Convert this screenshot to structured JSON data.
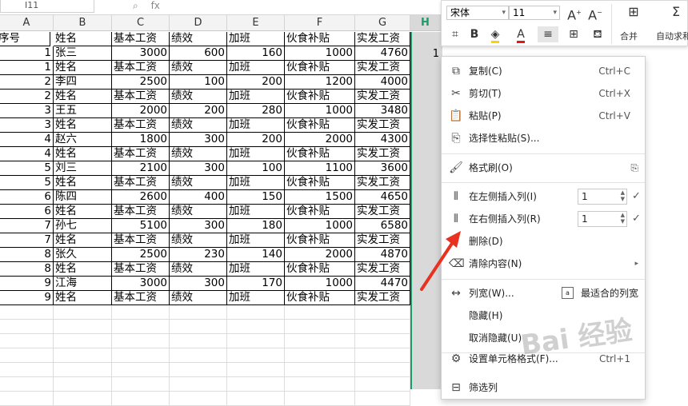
{
  "formula_bar": {
    "name_box": "I11",
    "fx": "fx"
  },
  "columns": [
    "A",
    "B",
    "C",
    "D",
    "E",
    "F",
    "G",
    "H"
  ],
  "rows": [
    [
      "序号",
      "姓名",
      "基本工资",
      "绩效",
      "加班",
      "伙食补贴",
      "实发工资"
    ],
    [
      "1",
      "张三",
      "3000",
      "600",
      "160",
      "1000",
      "4760"
    ],
    [
      "1",
      "姓名",
      "基本工资",
      "绩效",
      "加班",
      "伙食补贴",
      "实发工资"
    ],
    [
      "2",
      "李四",
      "2500",
      "100",
      "200",
      "1200",
      "4000"
    ],
    [
      "2",
      "姓名",
      "基本工资",
      "绩效",
      "加班",
      "伙食补贴",
      "实发工资"
    ],
    [
      "3",
      "王五",
      "2000",
      "200",
      "280",
      "1000",
      "3480"
    ],
    [
      "3",
      "姓名",
      "基本工资",
      "绩效",
      "加班",
      "伙食补贴",
      "实发工资"
    ],
    [
      "4",
      "赵六",
      "1800",
      "300",
      "200",
      "2000",
      "4300"
    ],
    [
      "4",
      "姓名",
      "基本工资",
      "绩效",
      "加班",
      "伙食补贴",
      "实发工资"
    ],
    [
      "5",
      "刘三",
      "2100",
      "300",
      "100",
      "1100",
      "3600"
    ],
    [
      "5",
      "姓名",
      "基本工资",
      "绩效",
      "加班",
      "伙食补贴",
      "实发工资"
    ],
    [
      "6",
      "陈四",
      "2600",
      "400",
      "150",
      "1500",
      "4650"
    ],
    [
      "6",
      "姓名",
      "基本工资",
      "绩效",
      "加班",
      "伙食补贴",
      "实发工资"
    ],
    [
      "7",
      "孙七",
      "5100",
      "300",
      "180",
      "1000",
      "6580"
    ],
    [
      "7",
      "姓名",
      "基本工资",
      "绩效",
      "加班",
      "伙食补贴",
      "实发工资"
    ],
    [
      "8",
      "张久",
      "2500",
      "230",
      "140",
      "2000",
      "4870"
    ],
    [
      "8",
      "姓名",
      "基本工资",
      "绩效",
      "加班",
      "伙食补贴",
      "实发工资"
    ],
    [
      "9",
      "江海",
      "3000",
      "300",
      "170",
      "1000",
      "4470"
    ],
    [
      "9",
      "姓名",
      "基本工资",
      "绩效",
      "加班",
      "伙食补贴",
      "实发工资"
    ]
  ],
  "h_column_value": "1",
  "toolbar": {
    "font_name": "宋体",
    "font_size": "11",
    "merge_label": "合并",
    "autofit_label": "自动求和"
  },
  "context_menu": {
    "copy": {
      "label": "复制(C)",
      "shortcut": "Ctrl+C"
    },
    "cut": {
      "label": "剪切(T)",
      "shortcut": "Ctrl+X"
    },
    "paste": {
      "label": "粘贴(P)",
      "shortcut": "Ctrl+V"
    },
    "paste_special": {
      "label": "选择性粘贴(S)..."
    },
    "format_painter": {
      "label": "格式刷(O)"
    },
    "insert_left": {
      "label": "在左侧插入列(I)",
      "value": "1"
    },
    "insert_right": {
      "label": "在右侧插入列(R)",
      "value": "1"
    },
    "delete": {
      "label": "删除(D)"
    },
    "clear": {
      "label": "清除内容(N)"
    },
    "col_width": {
      "label": "列宽(W)...",
      "best_fit": "最适合的列宽"
    },
    "hide": {
      "label": "隐藏(H)"
    },
    "unhide": {
      "label": "取消隐藏(U)"
    },
    "format_cells": {
      "label": "设置单元格格式(F)...",
      "shortcut": "Ctrl+1"
    },
    "filter": {
      "label": "筛选列"
    }
  },
  "colors": {
    "accent": "#1a9c6b",
    "arrow": "#e8311f"
  }
}
